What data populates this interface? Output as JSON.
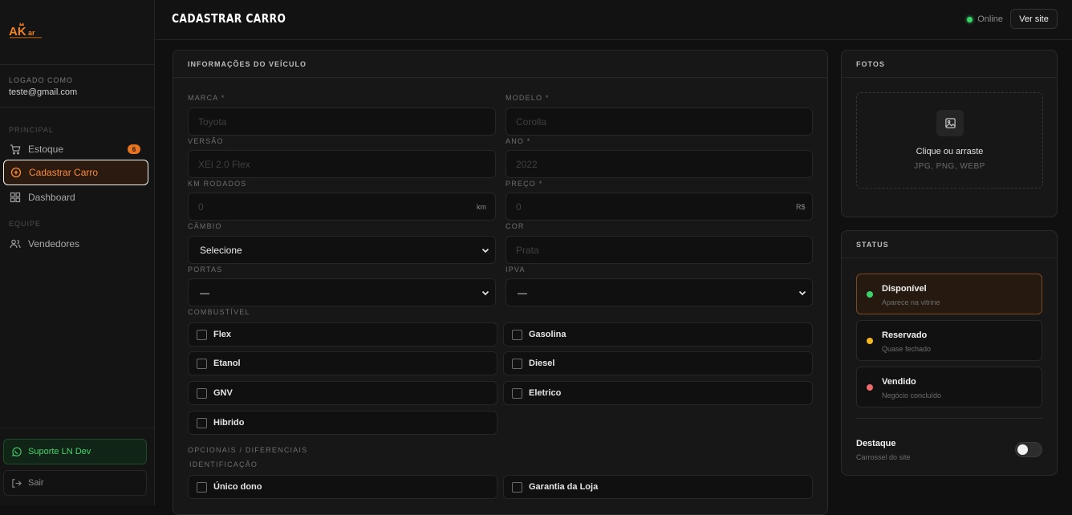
{
  "brand": {
    "logo_text": "AKar",
    "accent": "#e8741f"
  },
  "sidebar": {
    "logged_label": "LOGADO COMO",
    "email": "teste@gmail.com",
    "sections": [
      {
        "label": "PRINCIPAL"
      },
      {
        "label": "EQUIPE"
      }
    ],
    "items": [
      {
        "label": "Estoque",
        "icon": "cart-icon",
        "badge": "6"
      },
      {
        "label": "Cadastrar Carro",
        "icon": "plus-circle-icon",
        "active": true
      },
      {
        "label": "Dashboard",
        "icon": "grid-icon"
      },
      {
        "label": "Vendedores",
        "icon": "users-icon"
      }
    ],
    "support_label": "Suporte LN Dev",
    "logout_label": "Sair"
  },
  "header": {
    "title": "CADASTRAR CARRO",
    "online_label": "Online",
    "view_site_label": "Ver site"
  },
  "vehicle": {
    "section_title": "INFORMAÇÕES DO VEÍCULO",
    "fields": {
      "marca": {
        "label": "MARCA *",
        "placeholder": "Toyota"
      },
      "modelo": {
        "label": "MODELO *",
        "placeholder": "Corolla"
      },
      "versao": {
        "label": "VERSÃO",
        "placeholder": "XEi 2.0 Flex"
      },
      "ano": {
        "label": "ANO *",
        "placeholder": "2022"
      },
      "km": {
        "label": "KM RODADOS",
        "placeholder": "0",
        "suffix": "km"
      },
      "preco": {
        "label": "PREÇO *",
        "placeholder": "0",
        "suffix": "R$"
      },
      "cambio": {
        "label": "CÂMBIO",
        "value": "Selecione"
      },
      "cor": {
        "label": "COR",
        "placeholder": "Prata"
      },
      "portas": {
        "label": "PORTAS",
        "value": "—"
      },
      "ipva": {
        "label": "IPVA",
        "value": "—"
      }
    },
    "fuel_label": "COMBUSTÍVEL",
    "fuels": [
      "Flex",
      "Gasolina",
      "Etanol",
      "Diesel",
      "GNV",
      "Eletrico",
      "Hibrido"
    ],
    "extras_label": "OPCIONAIS / DIFERENCIAIS",
    "identification_label": "IDENTIFICAÇÃO",
    "extras": [
      "Único dono",
      "Garantia da Loja"
    ]
  },
  "photos": {
    "section_title": "FOTOS",
    "drop_title": "Clique ou arraste",
    "drop_formats": "JPG, PNG, WEBP"
  },
  "status": {
    "section_title": "STATUS",
    "options": [
      {
        "title": "Disponível",
        "sub": "Aparece na vitrine",
        "color": "#3dd36b",
        "selected": true
      },
      {
        "title": "Reservado",
        "sub": "Quase fechado",
        "color": "#f2b81f"
      },
      {
        "title": "Vendido",
        "sub": "Negócio concluído",
        "color": "#ef6a6a"
      }
    ],
    "highlight_title": "Destaque",
    "highlight_sub": "Carrossel do site",
    "highlight_on": false
  }
}
